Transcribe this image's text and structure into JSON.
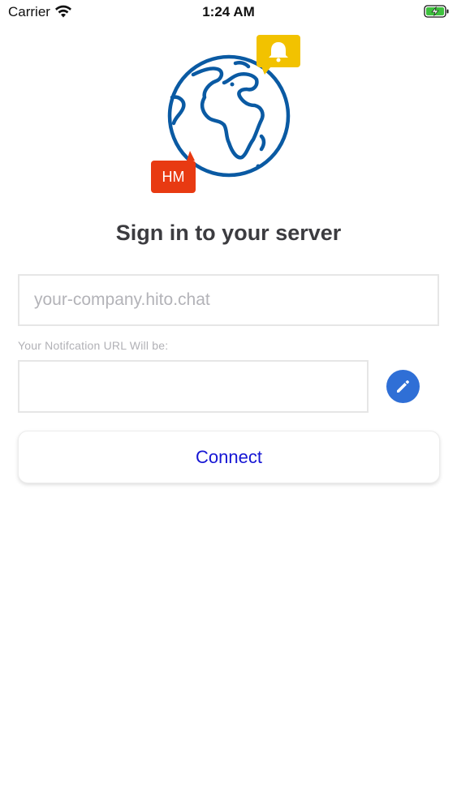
{
  "status_bar": {
    "carrier": "Carrier",
    "time": "1:24 AM",
    "wifi_icon": "wifi-icon",
    "battery_icon": "battery-charging-icon"
  },
  "logo": {
    "badge_text": "HM",
    "globe_icon": "globe-icon",
    "bell_icon": "bell-icon",
    "colors": {
      "globe": "#0a5aa3",
      "bell_bubble": "#f2c200",
      "hm_bubble": "#e83a12"
    }
  },
  "title": "Sign in to your server",
  "server_input": {
    "value": "",
    "placeholder": "your-company.hito.chat"
  },
  "notification": {
    "label": "Your Notifcation URL Will be:",
    "value": ""
  },
  "edit_button": {
    "icon": "pencil-icon",
    "color": "#2f6fd6"
  },
  "connect_button": {
    "label": "Connect",
    "color": "#1515d4"
  }
}
